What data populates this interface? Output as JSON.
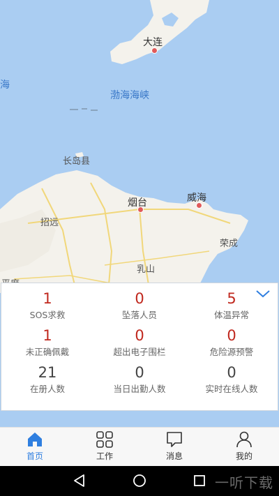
{
  "map": {
    "labels": {
      "dalian": "大连",
      "bohai_strait": "渤海海峡",
      "hai": "海",
      "changdao": "长岛县",
      "yantai": "烟台",
      "weihai": "威海",
      "zhaoyuan": "招远",
      "rongcheng": "荣成",
      "rushan": "乳山",
      "pingdu": "平度"
    },
    "colors": {
      "water": "#aacdf2",
      "land": "#f4f2ec",
      "road": "#f1d77a"
    }
  },
  "stats_panel": {
    "collapse_icon": "chevron-down-icon",
    "items": [
      {
        "value": "1",
        "label": "SOS求救",
        "color": "red"
      },
      {
        "value": "0",
        "label": "坠落人员",
        "color": "red"
      },
      {
        "value": "5",
        "label": "体温异常",
        "color": "red"
      },
      {
        "value": "1",
        "label": "未正确佩戴",
        "color": "red"
      },
      {
        "value": "0",
        "label": "超出电子围栏",
        "color": "red"
      },
      {
        "value": "0",
        "label": "危险源预警",
        "color": "red"
      },
      {
        "value": "21",
        "label": "在册人数",
        "color": "gray"
      },
      {
        "value": "0",
        "label": "当日出勤人数",
        "color": "gray"
      },
      {
        "value": "0",
        "label": "实时在线人数",
        "color": "gray"
      }
    ],
    "colors": {
      "red": "#c0281e",
      "gray": "#444444"
    }
  },
  "tabbar": {
    "active_color": "#2f7fe0",
    "tabs": [
      {
        "label": "首页",
        "icon": "home-icon",
        "active": true
      },
      {
        "label": "工作",
        "icon": "grid-icon",
        "active": false
      },
      {
        "label": "消息",
        "icon": "message-icon",
        "active": false
      },
      {
        "label": "我的",
        "icon": "user-icon",
        "active": false
      }
    ]
  },
  "system_nav": {
    "back_icon": "back-triangle-icon",
    "home_icon": "home-circle-icon",
    "recent_icon": "recent-square-icon",
    "watermark": "一听下载"
  }
}
